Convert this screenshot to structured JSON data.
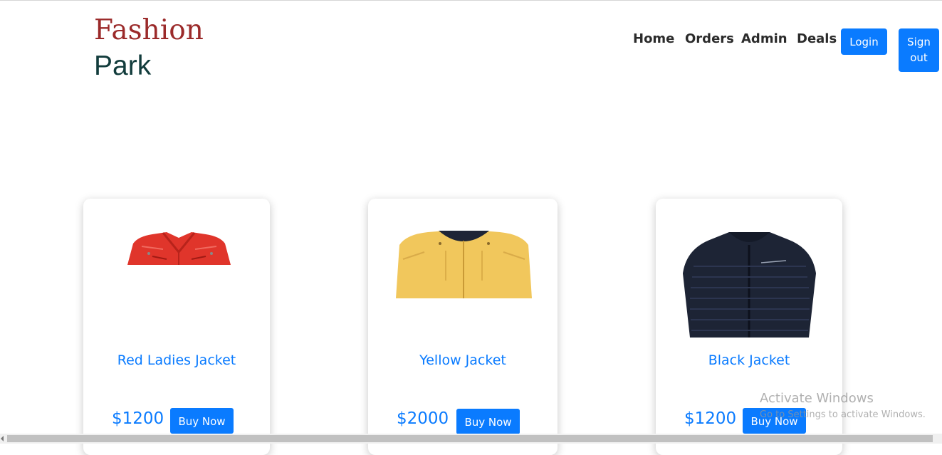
{
  "brand": {
    "line1": "Fashion",
    "line2": "Park"
  },
  "nav": {
    "items": [
      "Home",
      "Orders",
      "Admin",
      "Deals"
    ],
    "login_label": "Login",
    "signout_label": "Sign\nout"
  },
  "products": [
    {
      "name": "Red Ladies Jacket",
      "price": "$1200",
      "button": "Buy Now",
      "image_icon": "red-jacket-image"
    },
    {
      "name": "Yellow Jacket",
      "price": "$2000",
      "button": "Buy Now",
      "image_icon": "yellow-jacket-image"
    },
    {
      "name": "Black Jacket",
      "price": "$1200",
      "button": "Buy Now",
      "image_icon": "black-jacket-image"
    }
  ],
  "watermark": {
    "title": "Activate Windows",
    "subtitle": "Go to Settings to activate Windows."
  },
  "colors": {
    "accent": "#0a7bff",
    "brand_red": "#9b2a2a",
    "brand_dark": "#123c3c"
  }
}
